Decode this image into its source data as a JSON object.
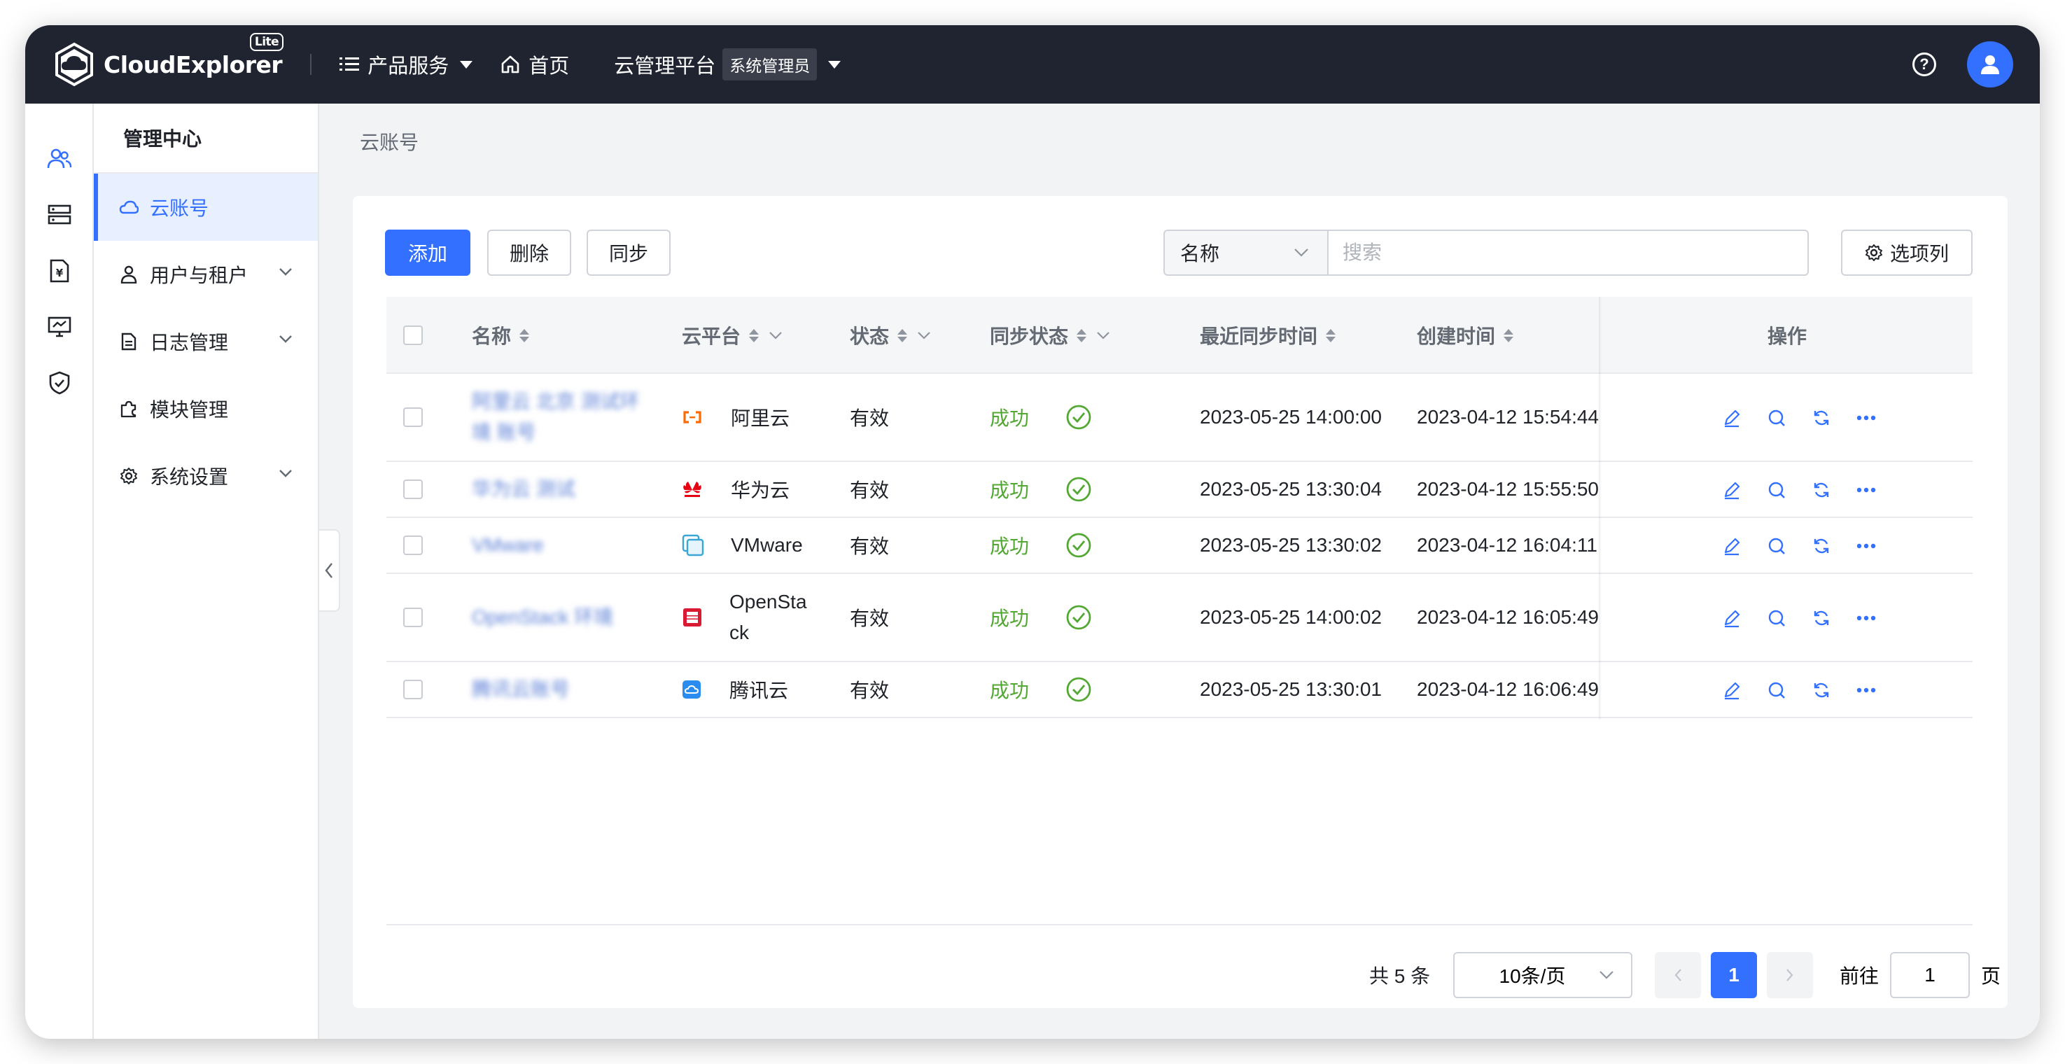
{
  "app": {
    "name": "CloudExplorer",
    "edition": "Lite"
  },
  "topnav": {
    "products_label": "产品服务",
    "home_label": "首页",
    "platform_label": "云管理平台",
    "role_label": "系统管理员"
  },
  "sidemenu": {
    "title": "管理中心",
    "items": [
      {
        "label": "云账号",
        "icon": "cloud-icon",
        "active": true
      },
      {
        "label": "用户与租户",
        "icon": "user-icon",
        "expandable": true
      },
      {
        "label": "日志管理",
        "icon": "file-icon",
        "expandable": true
      },
      {
        "label": "模块管理",
        "icon": "puzzle-icon"
      },
      {
        "label": "系统设置",
        "icon": "gear-icon",
        "expandable": true
      }
    ]
  },
  "breadcrumb": "云账号",
  "toolbar": {
    "add_label": "添加",
    "delete_label": "删除",
    "sync_label": "同步",
    "search_field": "名称",
    "search_placeholder": "搜索",
    "columns_label": "选项列"
  },
  "table": {
    "headers": {
      "name": "名称",
      "platform": "云平台",
      "status": "状态",
      "sync_status": "同步状态",
      "last_sync": "最近同步时间",
      "created": "创建时间",
      "actions": "操作"
    },
    "rows": [
      {
        "name": "阿里云 北京 测试环境 账号",
        "platform": "阿里云",
        "platform_icon": "aliyun-icon",
        "platform_color": "#ff6a00",
        "status": "有效",
        "sync_status": "成功",
        "last_sync": "2023-05-25 14:00:00",
        "created": "2023-04-12 15:54:44"
      },
      {
        "name": "华为云 测试",
        "platform": "华为云",
        "platform_icon": "huawei-icon",
        "platform_color": "#e60012",
        "status": "有效",
        "sync_status": "成功",
        "last_sync": "2023-05-25 13:30:04",
        "created": "2023-04-12 15:55:50"
      },
      {
        "name": "VMware",
        "platform": "VMware",
        "platform_icon": "vmware-icon",
        "platform_color": "#3aa6d6",
        "status": "有效",
        "sync_status": "成功",
        "last_sync": "2023-05-25 13:30:02",
        "created": "2023-04-12 16:04:11"
      },
      {
        "name": "OpenStack 环境",
        "platform": "OpenSta\nck",
        "platform_icon": "openstack-icon",
        "platform_color": "#da1a32",
        "status": "有效",
        "sync_status": "成功",
        "last_sync": "2023-05-25 14:00:02",
        "created": "2023-04-12 16:05:49"
      },
      {
        "name": "腾讯云账号",
        "platform": "腾讯云",
        "platform_icon": "tencent-icon",
        "platform_color": "#2b8cf0",
        "status": "有效",
        "sync_status": "成功",
        "last_sync": "2023-05-25 13:30:01",
        "created": "2023-04-12 16:06:49"
      }
    ]
  },
  "pagination": {
    "total_label": "共 5 条",
    "page_size_label": "10条/页",
    "current_page": "1",
    "goto_label": "前往",
    "goto_value": "1",
    "page_unit": "页"
  },
  "colors": {
    "accent": "#3370ff",
    "topbar": "#1f2430",
    "success": "#52a832"
  }
}
